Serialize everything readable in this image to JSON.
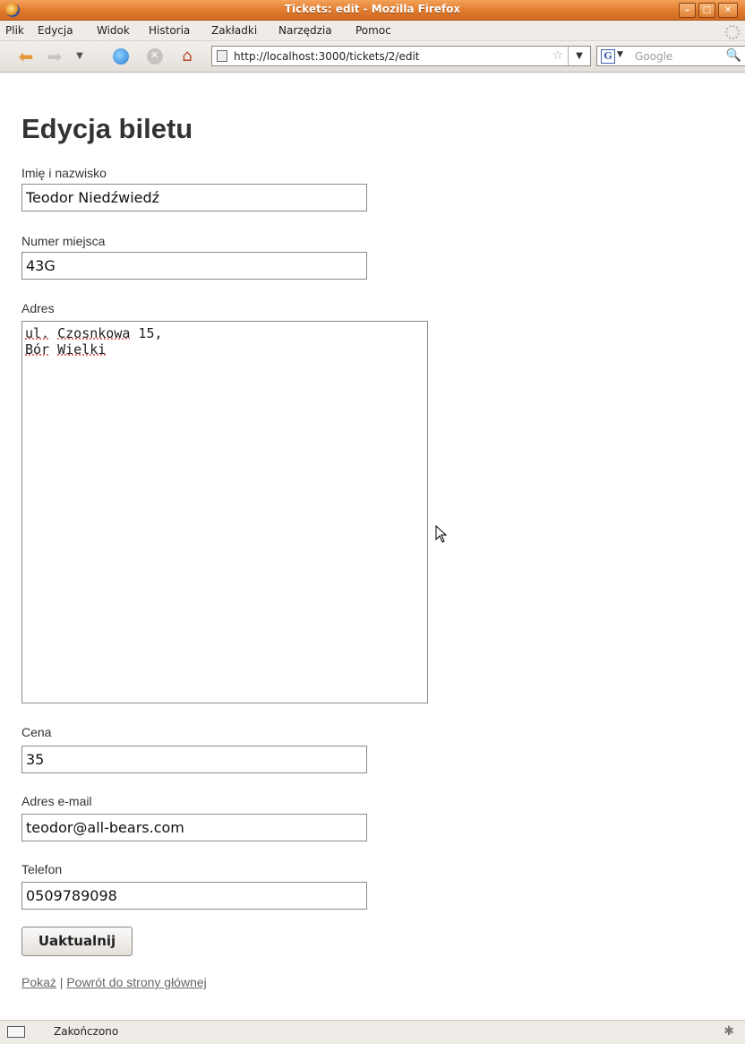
{
  "window": {
    "title": "Tickets: edit - Mozilla Firefox",
    "buttons": {
      "minimize": "–",
      "maximize": "□",
      "close": "✕"
    }
  },
  "menu": [
    "Plik",
    "Edycja",
    "Widok",
    "Historia",
    "Zakładki",
    "Narzędzia",
    "Pomoc"
  ],
  "nav": {
    "url": "http://localhost:3000/tickets/2/edit",
    "search_placeholder": "Google",
    "icons": [
      "back-arrow-icon",
      "forward-arrow-icon",
      "history-dropdown-icon",
      "reload-icon",
      "stop-icon",
      "home-icon"
    ]
  },
  "page": {
    "heading": "Edycja biletu",
    "fields": {
      "name": {
        "label": "Imię i nazwisko",
        "value": "Teodor Niedźwiedź"
      },
      "seat": {
        "label": "Numer miejsca",
        "value": "43G"
      },
      "address": {
        "label": "Adres",
        "line1_a": "ul.",
        "line1_b": "Czosnkowa",
        "line1_c": " 15,",
        "line2_a": "Bór",
        "line2_b": "Wielki"
      },
      "price": {
        "label": "Cena",
        "value": "35"
      },
      "email": {
        "label": "Adres e-mail",
        "value": "teodor@all-bears.com"
      },
      "phone": {
        "label": "Telefon",
        "value": "0509789098"
      }
    },
    "submit_label": "Uaktualnij",
    "link_show": "Pokaż",
    "link_separator": " | ",
    "link_back": "Powrót do strony głównej"
  },
  "status": {
    "text": "Zakończono"
  }
}
